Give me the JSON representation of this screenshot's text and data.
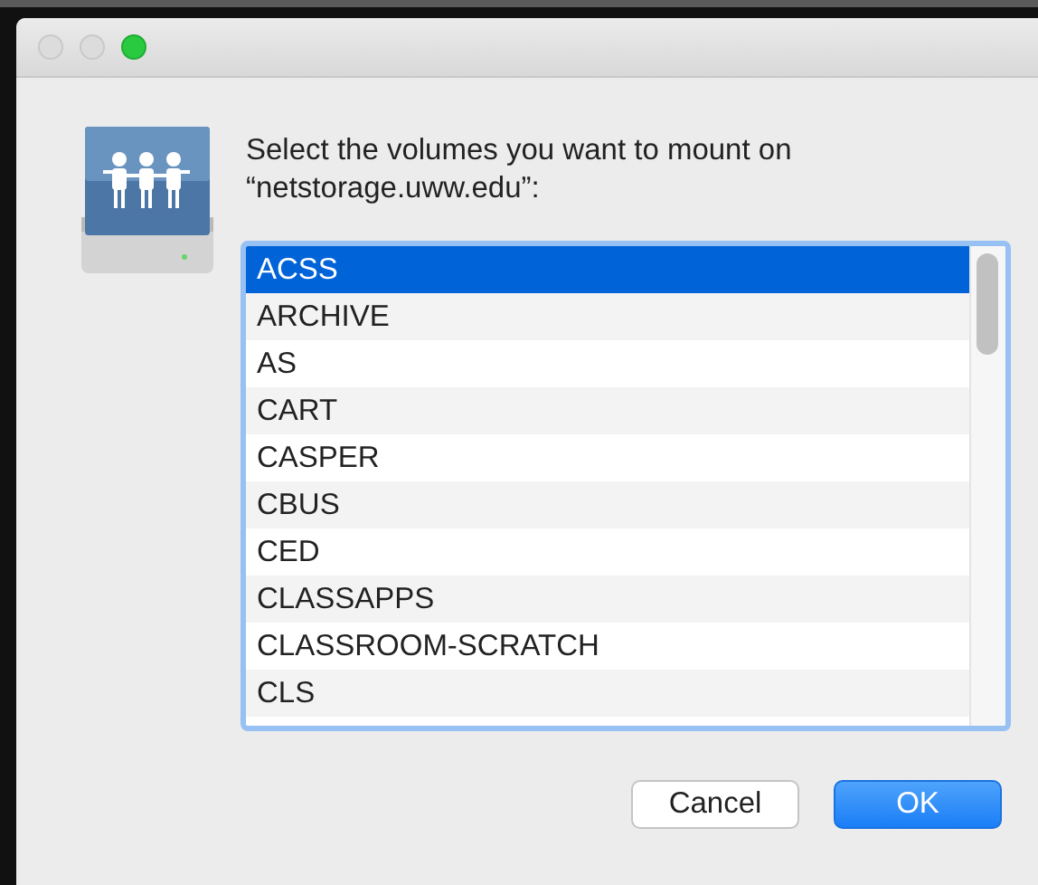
{
  "window": {
    "traffic_lights": [
      {
        "kind": "close",
        "active": false
      },
      {
        "kind": "minimize",
        "active": false
      },
      {
        "kind": "zoom",
        "active": true
      }
    ]
  },
  "prompt": "Select the volumes you want to mount on “netstorage.uww.edu”:",
  "volumes": [
    {
      "name": "ACSS",
      "selected": true
    },
    {
      "name": "ARCHIVE",
      "selected": false
    },
    {
      "name": "AS",
      "selected": false
    },
    {
      "name": "CART",
      "selected": false
    },
    {
      "name": "CASPER",
      "selected": false
    },
    {
      "name": "CBUS",
      "selected": false
    },
    {
      "name": "CED",
      "selected": false
    },
    {
      "name": "CLASSAPPS",
      "selected": false
    },
    {
      "name": "CLASSROOM-SCRATCH",
      "selected": false
    },
    {
      "name": "CLS",
      "selected": false
    }
  ],
  "buttons": [
    {
      "label": "Cancel",
      "kind": "default"
    },
    {
      "label": "OK",
      "kind": "primary"
    }
  ]
}
